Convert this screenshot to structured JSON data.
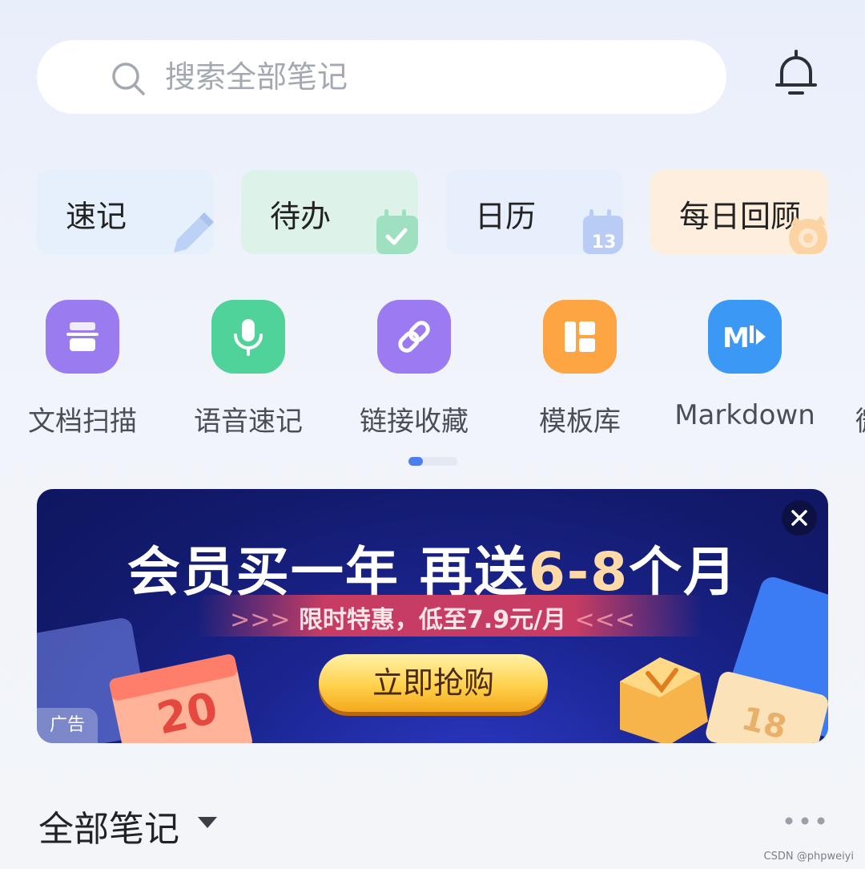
{
  "search": {
    "placeholder": "搜索全部笔记"
  },
  "quick_cards": [
    {
      "label": "速记",
      "icon": "pencil-icon"
    },
    {
      "label": "待办",
      "icon": "calendar-check-icon"
    },
    {
      "label": "日历",
      "icon": "calendar-13-icon",
      "badge": "13"
    },
    {
      "label": "每日回顾",
      "icon": "review-icon"
    }
  ],
  "tools": [
    {
      "label": "文档扫描",
      "icon": "scanner-icon"
    },
    {
      "label": "语音速记",
      "icon": "microphone-icon"
    },
    {
      "label": "链接收藏",
      "icon": "link-icon"
    },
    {
      "label": "模板库",
      "icon": "template-icon"
    },
    {
      "label": "Markdown",
      "icon": "markdown-icon",
      "glyph": "M"
    },
    {
      "label": "微"
    }
  ],
  "pager": {
    "pages": 2,
    "current": 1
  },
  "banner": {
    "headline_a": "会员买一年 再送",
    "headline_b": "6-8",
    "headline_c": "个月",
    "sub": "限时特惠，低至7.9元/月",
    "chev_left": ">>>",
    "chev_right": "<<<",
    "cta": "立即抢购",
    "ad_tag": "广告",
    "deco_left_num": "20",
    "deco_right_num": "18"
  },
  "notes": {
    "title": "全部笔记"
  },
  "watermark": "CSDN @phpweiyi",
  "colors": {
    "accent": "#4d7ef0",
    "card_quick": "#e6effc",
    "card_todo": "#ddf3e9",
    "card_calendar": "#e8effc",
    "card_review": "#fdeedd",
    "banner_bg": "#1b2591",
    "cta": "#ffd04a"
  }
}
